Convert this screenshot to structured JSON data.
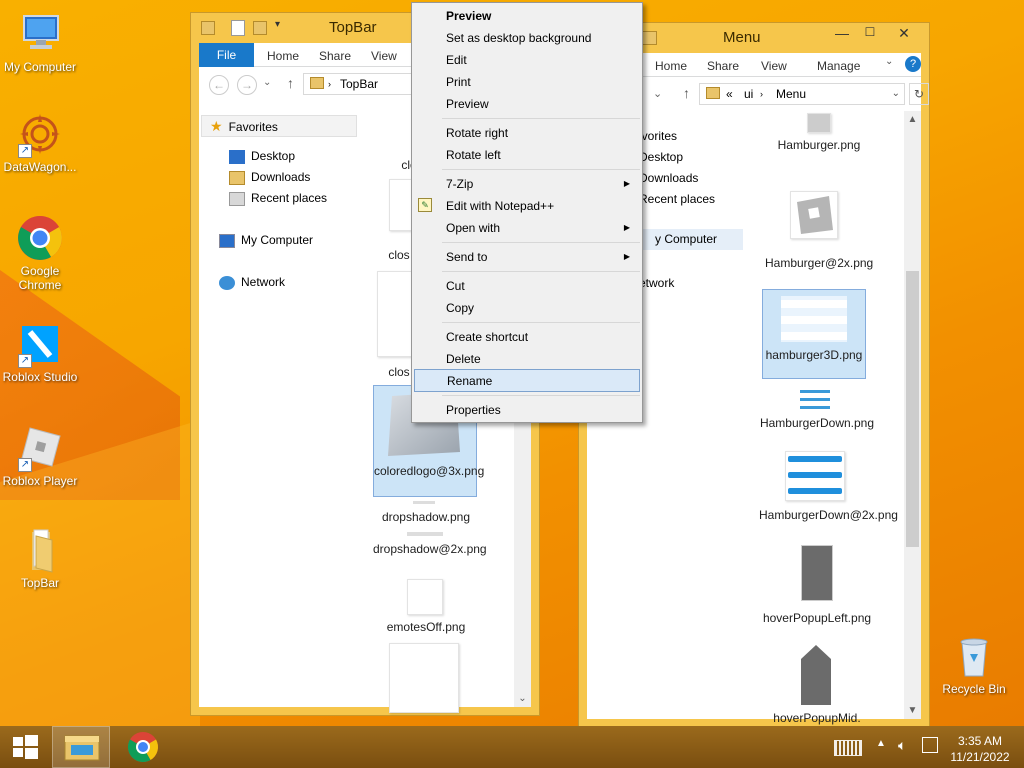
{
  "desktop": {
    "icons": [
      {
        "label": "My Computer"
      },
      {
        "label": "DataWagon..."
      },
      {
        "label": "Google Chrome"
      },
      {
        "label": "Roblox Studio"
      },
      {
        "label": "Roblox Player"
      },
      {
        "label": "TopBar"
      },
      {
        "label": "Recycle Bin"
      }
    ]
  },
  "left_window": {
    "title": "TopBar",
    "ribbon": {
      "file": "File",
      "home": "Home",
      "share": "Share",
      "view": "View"
    },
    "address": {
      "path": "TopBar"
    },
    "nav": {
      "favorites": "Favorites",
      "desktop": "Desktop",
      "downloads": "Downloads",
      "recent": "Recent places",
      "my_computer": "My Computer",
      "network": "Network"
    },
    "files": [
      {
        "name": "clo"
      },
      {
        "name": "clos"
      },
      {
        "name": "clos"
      },
      {
        "name": "coloredlogo@3x.png"
      },
      {
        "name": "dropshadow.png"
      },
      {
        "name": "dropshadow@2x.png"
      },
      {
        "name": "emotesOff.png"
      }
    ]
  },
  "right_window": {
    "title": "Menu",
    "ribbon": {
      "home": "Home",
      "share": "Share",
      "view": "View",
      "manage": "Manage"
    },
    "address": {
      "prefix": "«",
      "seg1": "ui",
      "seg2": "Menu"
    },
    "nav": {
      "favorites": "avorites",
      "desktop": "Desktop",
      "downloads": "Downloads",
      "recent": "Recent places",
      "my_computer": "y Computer",
      "network": "etwork"
    },
    "files": [
      {
        "name": "Hamburger.png"
      },
      {
        "name": "Hamburger@2x.png"
      },
      {
        "name": "hamburger3D.png"
      },
      {
        "name": "HamburgerDown.png"
      },
      {
        "name": "HamburgerDown@2x.png"
      },
      {
        "name": "hoverPopupLeft.png"
      },
      {
        "name": "hoverPopupMid."
      }
    ]
  },
  "context_menu": {
    "preview_bold": "Preview",
    "set_bg": "Set as desktop background",
    "edit": "Edit",
    "print": "Print",
    "preview": "Preview",
    "rotate_right": "Rotate right",
    "rotate_left": "Rotate left",
    "zip": "7-Zip",
    "notepad": "Edit with Notepad++",
    "open_with": "Open with",
    "send_to": "Send to",
    "cut": "Cut",
    "copy": "Copy",
    "create_shortcut": "Create shortcut",
    "delete": "Delete",
    "rename": "Rename",
    "properties": "Properties"
  },
  "taskbar": {
    "time": "3:35 AM",
    "date": "11/21/2022"
  },
  "colors": {
    "accent": "#1979ca",
    "selection": "#cce4f7",
    "window_frame": "#f6c64b",
    "taskbar": "#8a5a14"
  }
}
